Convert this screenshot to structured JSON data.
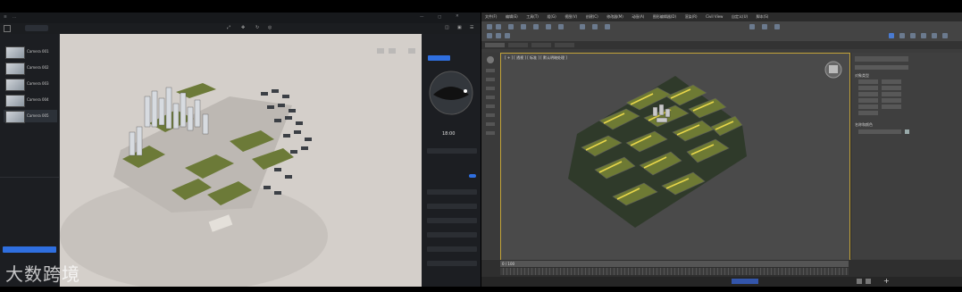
{
  "left_app": {
    "title_left": "...",
    "cameras_header": "",
    "cameras": [
      "Camera 001",
      "Camera 002",
      "Camera 003",
      "Camera 004",
      "Camera 005"
    ],
    "layers_header": "",
    "layer_item": "",
    "assets_header": "",
    "primary_button": "",
    "panel_time": "18:00",
    "tab_a": "",
    "tab_b": "",
    "accent": "#2f6fe0",
    "ground_color": "#6a7a3a"
  },
  "right_app": {
    "viewport_label": "[ + ] [ 透视 ] [ 标准 ] [ 默认明暗处理 ]",
    "menus": [
      "文件(F)",
      "编辑(E)",
      "工具(T)",
      "组(G)",
      "视图(V)",
      "创建(C)",
      "修改器(M)",
      "动画(A)",
      "图形编辑器(D)",
      "渲染(R)",
      "Civil View",
      "自定义(U)",
      "脚本(S)",
      "Interactive",
      "内容",
      "Arnold",
      "帮助(H)"
    ],
    "cmd_section_1": "对象类型",
    "cmd_section_2": "名称和颜色",
    "highlight_color": "#e8d64a",
    "frame_counter": "0 / 100"
  },
  "watermark": "大数跨境"
}
